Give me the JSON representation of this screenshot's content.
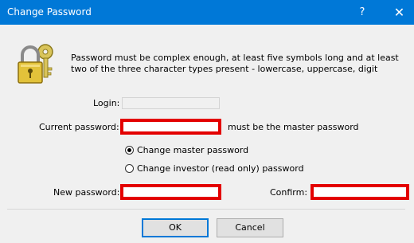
{
  "window": {
    "title": "Change Password",
    "help_label": "?",
    "close_label": "✕"
  },
  "description": "Password must be complex enough, at least five symbols long and at least two of the three character types present - lowercase, uppercase, digit",
  "form": {
    "login_label": "Login:",
    "login_value": "",
    "current_password_label": "Current password:",
    "current_password_hint": "must be the master password",
    "radio_master_label": "Change master password",
    "radio_investor_label": "Change investor (read only) password",
    "selected_radio": "master",
    "new_password_label": "New password:",
    "confirm_label": "Confirm:"
  },
  "buttons": {
    "ok_label": "OK",
    "cancel_label": "Cancel"
  },
  "colors": {
    "titlebar": "#0078d7",
    "highlight_border": "#e30000"
  },
  "icons": {
    "dialog": "padlock-keys-icon"
  }
}
